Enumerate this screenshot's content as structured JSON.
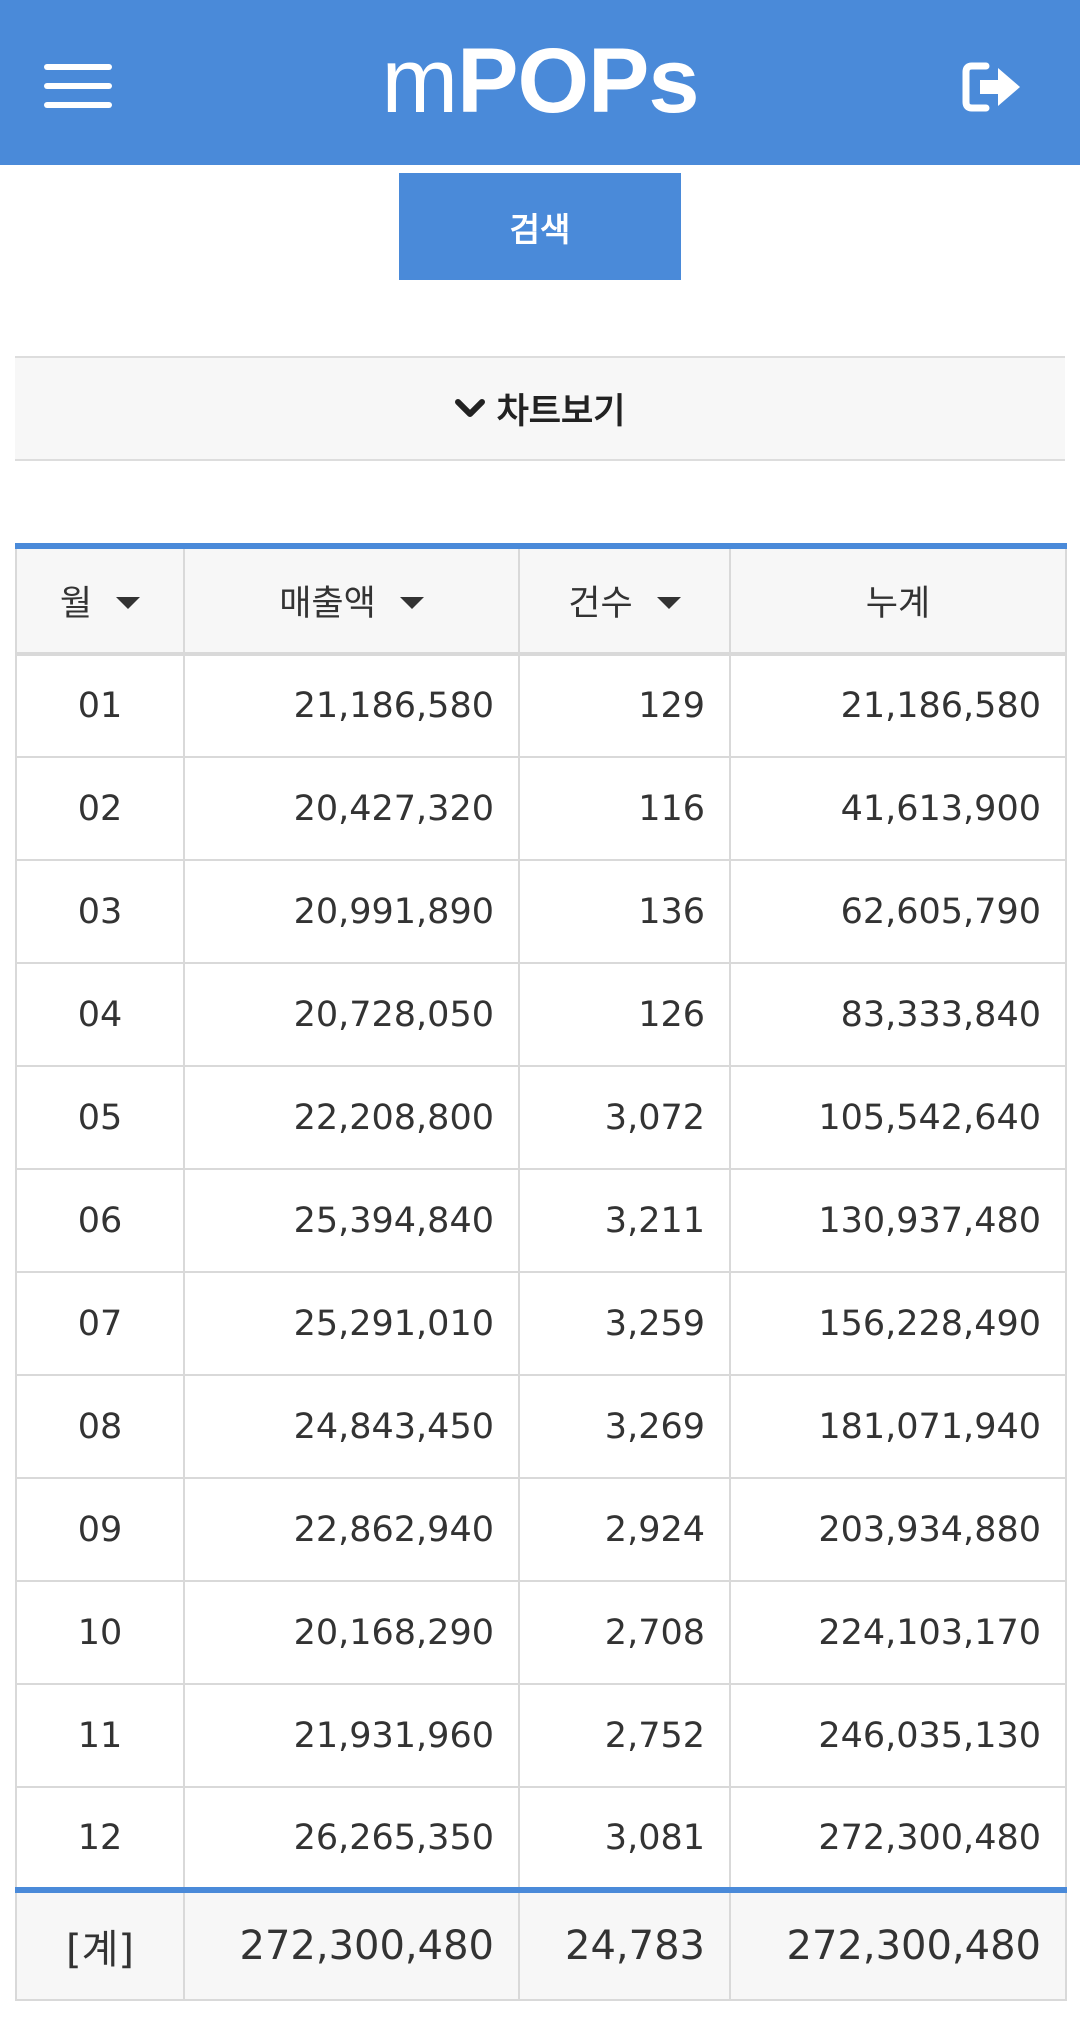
{
  "header": {
    "menu_icon": "hamburger-menu-icon",
    "brand_m": "m",
    "brand_pops": "POPs",
    "logout_icon": "logout-icon"
  },
  "search": {
    "button_label": "검색"
  },
  "chart_toggle": {
    "icon": "chevron-down-icon",
    "label": "차트보기"
  },
  "table": {
    "headers": [
      "월",
      "매출액",
      "건수",
      "누계"
    ],
    "sortable": [
      true,
      true,
      true,
      false
    ],
    "rows": [
      [
        "01",
        "21,186,580",
        "129",
        "21,186,580"
      ],
      [
        "02",
        "20,427,320",
        "116",
        "41,613,900"
      ],
      [
        "03",
        "20,991,890",
        "136",
        "62,605,790"
      ],
      [
        "04",
        "20,728,050",
        "126",
        "83,333,840"
      ],
      [
        "05",
        "22,208,800",
        "3,072",
        "105,542,640"
      ],
      [
        "06",
        "25,394,840",
        "3,211",
        "130,937,480"
      ],
      [
        "07",
        "25,291,010",
        "3,259",
        "156,228,490"
      ],
      [
        "08",
        "24,843,450",
        "3,269",
        "181,071,940"
      ],
      [
        "09",
        "22,862,940",
        "2,924",
        "203,934,880"
      ],
      [
        "10",
        "20,168,290",
        "2,708",
        "224,103,170"
      ],
      [
        "11",
        "21,931,960",
        "2,752",
        "246,035,130"
      ],
      [
        "12",
        "26,265,350",
        "3,081",
        "272,300,480"
      ]
    ],
    "total": [
      "[계]",
      "272,300,480",
      "24,783",
      "272,300,480"
    ]
  },
  "colors": {
    "accent": "#4a8ad9",
    "header_bg": "#f7f7f7",
    "border": "#d9d9d9"
  }
}
